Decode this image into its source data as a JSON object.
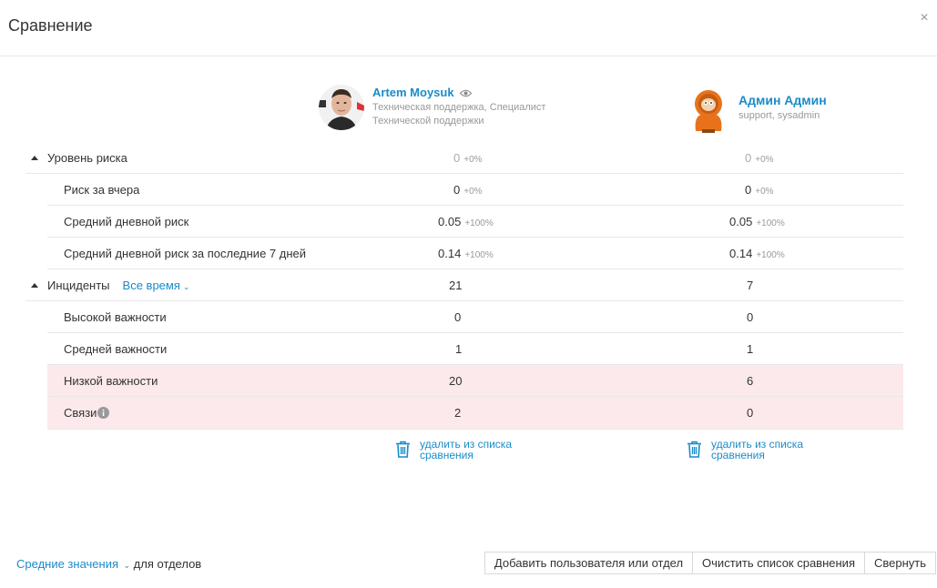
{
  "dialog": {
    "title": "Сравнение",
    "close_label": "×"
  },
  "users": [
    {
      "name": "Artem Moysuk",
      "subtitle": "Техническая поддержка, Специалист Технической поддержки"
    },
    {
      "name": "Админ Админ",
      "subtitle": "support, sysadmin"
    }
  ],
  "sections": {
    "risk": {
      "label": "Уровень риска",
      "values": [
        "0",
        "0"
      ],
      "deltas": [
        "+0%",
        "+0%"
      ],
      "rows": [
        {
          "label": "Риск за вчера",
          "values": [
            "0",
            "0"
          ],
          "deltas": [
            "+0%",
            "+0%"
          ]
        },
        {
          "label": "Средний дневной риск",
          "values": [
            "0.05",
            "0.05"
          ],
          "deltas": [
            "+100%",
            "+100%"
          ]
        },
        {
          "label": "Средний дневной риск за последние 7 дней",
          "values": [
            "0.14",
            "0.14"
          ],
          "deltas": [
            "+100%",
            "+100%"
          ]
        }
      ]
    },
    "incidents": {
      "label": "Инциденты",
      "filter": "Все время",
      "values": [
        "21",
        "7"
      ],
      "rows": [
        {
          "label": "Высокой важности",
          "values": [
            "0",
            "0"
          ]
        },
        {
          "label": "Средней важности",
          "values": [
            "1",
            "1"
          ]
        },
        {
          "label": "Низкой важности",
          "values": [
            "20",
            "6"
          ]
        },
        {
          "label": "Связи",
          "values": [
            "2",
            "0"
          ]
        }
      ]
    }
  },
  "remove_label": "удалить из списка сравнения",
  "footer": {
    "avg_link": "Средние значения",
    "avg_suffix": "для отделов",
    "buttons": {
      "add": "Добавить пользователя или отдел",
      "clear": "Очистить список сравнения",
      "collapse": "Свернуть"
    }
  },
  "colors": {
    "accent": "#1a8cc9",
    "highlight_row": "#fbe9ec"
  }
}
